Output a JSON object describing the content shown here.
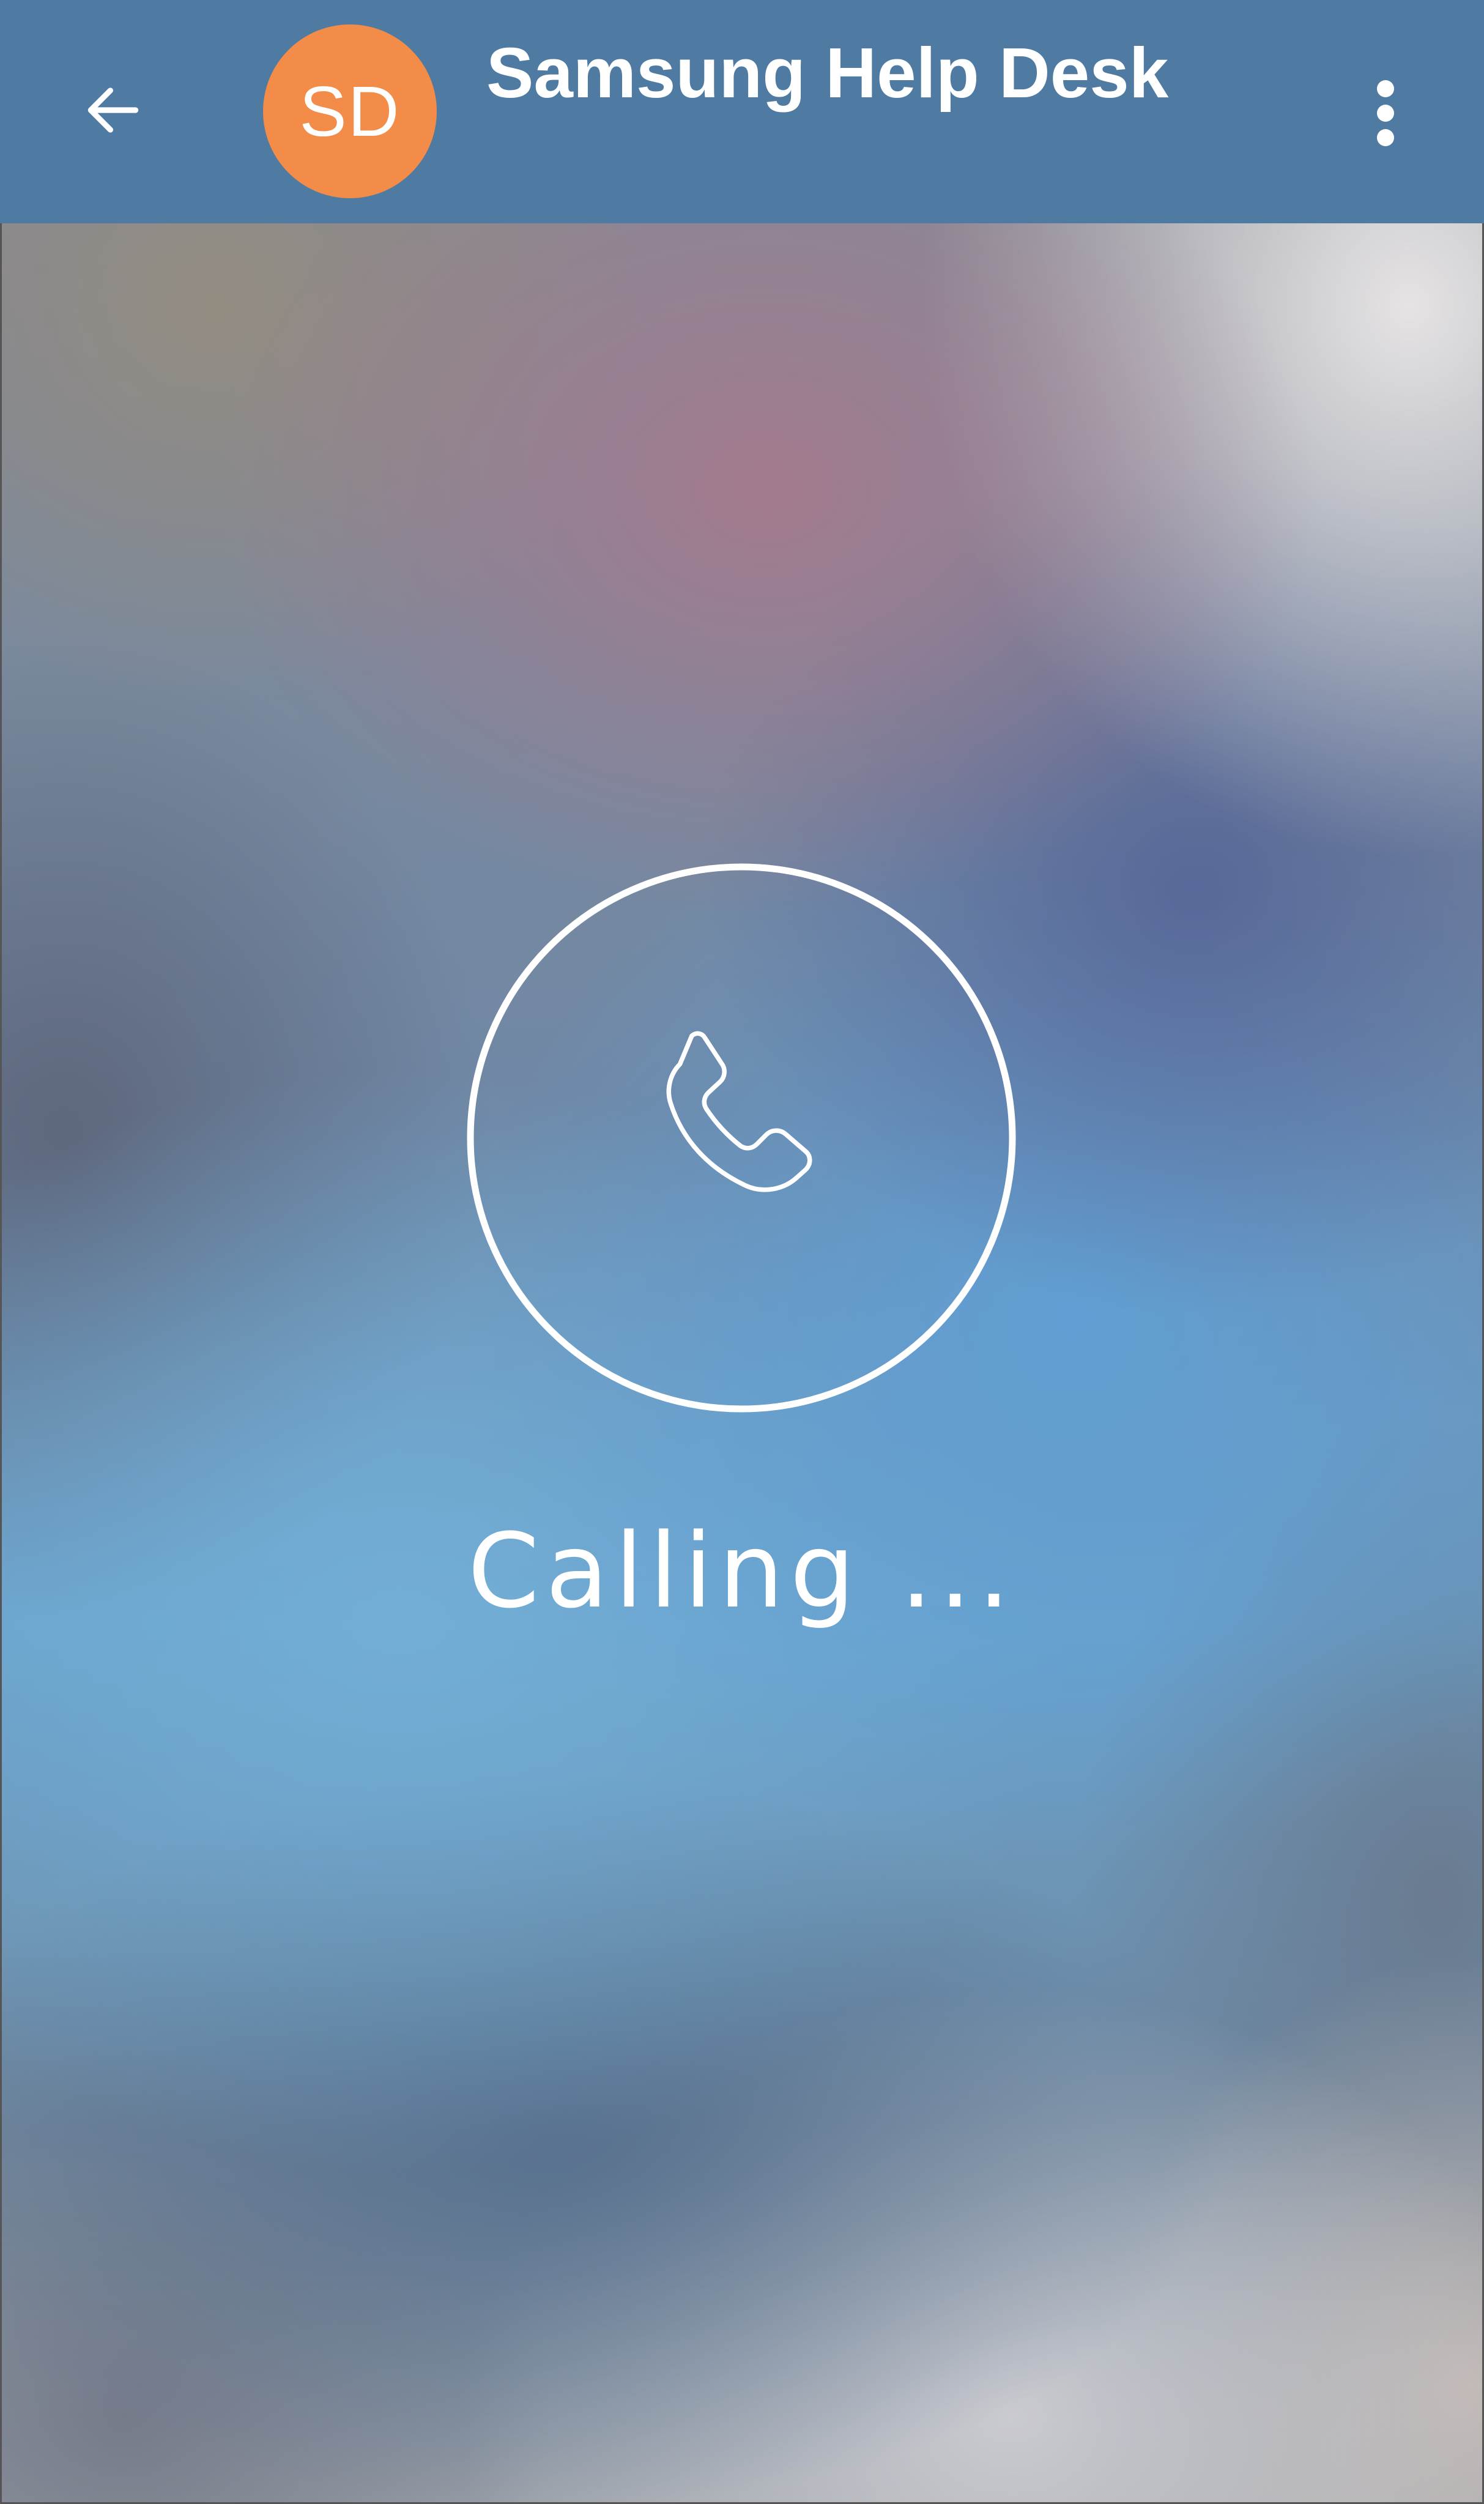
{
  "header": {
    "back_icon": "arrow-back-icon",
    "avatar_initials": "SD",
    "avatar_color": "#f28c48",
    "title": "Samsung Help Desk",
    "menu_icon": "more-vertical-icon",
    "background_color": "#4f7ba3"
  },
  "call": {
    "icon": "phone-icon",
    "status": "Calling ..."
  }
}
